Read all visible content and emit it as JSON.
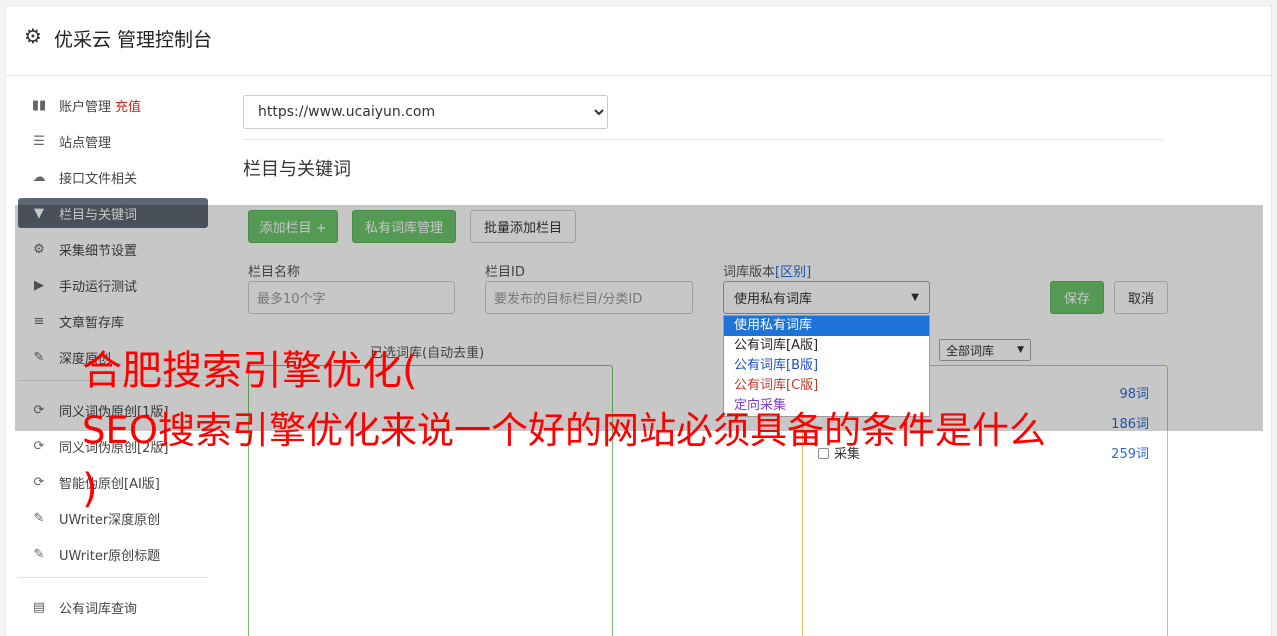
{
  "header": {
    "title": "优采云 管理控制台",
    "icon": "gear-icon"
  },
  "sidebar": {
    "items": [
      {
        "label": "账户管理",
        "extra": "充值",
        "icon": "bar-chart-icon"
      },
      {
        "label": "站点管理",
        "icon": "server-icon"
      },
      {
        "label": "接口文件相关",
        "icon": "cloud-upload-icon"
      },
      {
        "label": "栏目与关键词",
        "icon": "filter-icon",
        "active": true
      },
      {
        "label": "采集细节设置",
        "icon": "gears-icon"
      },
      {
        "label": "手动运行测试",
        "icon": "play-circle-icon"
      },
      {
        "label": "文章暂存库",
        "icon": "database-icon"
      },
      {
        "label": "深度原创",
        "icon": "edit-icon"
      }
    ],
    "items2": [
      {
        "label": "同义词伪原创[1版]",
        "icon": "refresh-icon"
      },
      {
        "label": "同义词伪原创[2版]",
        "icon": "refresh-icon"
      },
      {
        "label": "智能伪原创[AI版]",
        "icon": "refresh-icon"
      },
      {
        "label": "UWriter深度原创",
        "icon": "edit-icon"
      },
      {
        "label": "UWriter原创标题",
        "icon": "edit-icon"
      }
    ],
    "items3": [
      {
        "label": "公有词库查询",
        "icon": "book-icon"
      }
    ]
  },
  "main": {
    "site_url": "https://www.ucaiyun.com",
    "section_title": "栏目与关键词",
    "buttons": {
      "add_column": "添加栏目 +",
      "private_lib": "私有词库管理",
      "batch_add": "批量添加栏目",
      "save": "保存",
      "cancel": "取消"
    },
    "form": {
      "name_label": "栏目名称",
      "name_placeholder": "最多10个字",
      "id_label": "栏目ID",
      "id_placeholder": "要发布的目标栏目/分类ID",
      "version_label": "词库版本",
      "version_diff": "[区别]",
      "version_value": "使用私有词库"
    },
    "dropdown_options": [
      "使用私有词库",
      "公有词库[A版]",
      "公有词库[B版]",
      "公有词库[C版]",
      "定向采集"
    ],
    "selected_label": "已选词库(自动去重)",
    "filter_select": "全部词库",
    "libs": [
      {
        "name": "",
        "count": "98词"
      },
      {
        "name": "",
        "count": "186词"
      },
      {
        "name": "采集",
        "count": "259词"
      }
    ]
  },
  "overlay_text": {
    "line1": "合肥搜索引擎优化(",
    "line2": "SEO搜索引擎优化来说一个好的网站必须具备的条件是什么",
    "line3": ")"
  },
  "colors": {
    "accent_green": "#6cc46c",
    "active_nav": "#5f6773",
    "overlay_text": "#ff0000"
  }
}
